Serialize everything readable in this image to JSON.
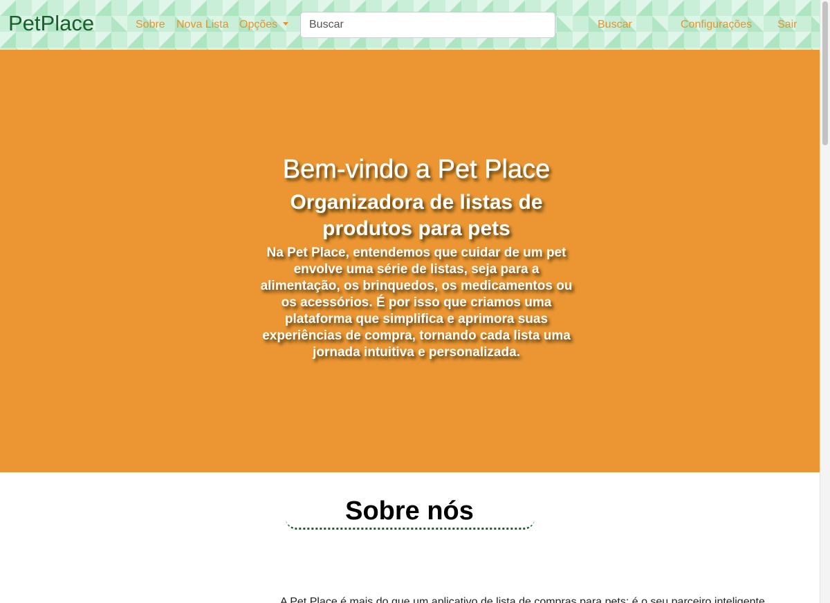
{
  "navbar": {
    "brand": "PetPlace",
    "links": {
      "sobre": "Sobre",
      "nova_lista": "Nova Lista",
      "opcoes": "Opções"
    },
    "search": {
      "placeholder": "Buscar",
      "value": ""
    },
    "search_button": "Buscar",
    "configuracoes": "Configurações",
    "sair": "Sair"
  },
  "hero": {
    "title": "Bem-vindo a Pet Place",
    "subtitle": "Organizadora de listas de produtos para pets",
    "text": "Na Pet Place, entendemos que cuidar de um pet envolve uma série de listas, seja para a alimentação, os brinquedos, os medicamentos ou os acessórios. É por isso que criamos uma plataforma que simplifica e aprimora suas experiências de compra, tornando cada lista uma jornada intuitiva e personalizada."
  },
  "about": {
    "heading": "Sobre nós",
    "text": "A Pet Place é mais do que um aplicativo de lista de compras para pets; é o seu parceiro inteligente"
  },
  "colors": {
    "accent": "#e8932c",
    "hero_background": "#ec9633",
    "brand": "#1a5e2c",
    "navbar_background": "#c9efd8"
  },
  "icons": {
    "dropdown": "chevron-down-icon"
  }
}
